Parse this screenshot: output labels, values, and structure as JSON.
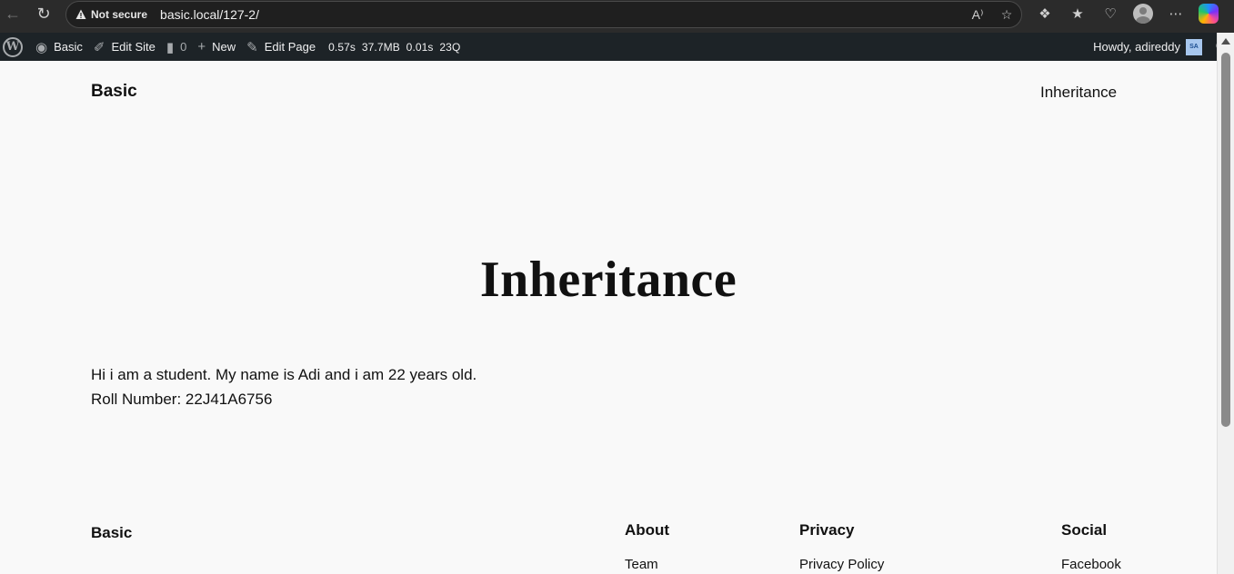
{
  "browser": {
    "security_label": "Not secure",
    "url": "basic.local/127-2/"
  },
  "admin_bar": {
    "site_name": "Basic",
    "edit_site": "Edit Site",
    "comments_count": "0",
    "new_label": "New",
    "edit_page": "Edit Page",
    "stats": "0.57s  37.7MB  0.01s  23Q",
    "howdy": "Howdy, adireddy",
    "avatar_initials": "SA"
  },
  "site": {
    "title": "Basic",
    "nav_link": "Inheritance"
  },
  "page": {
    "title": "Inheritance",
    "lines": [
      "Hi i am a student. My name is Adi and i am 22 years old.",
      "Roll Number: 22J41A6756"
    ]
  },
  "footer": {
    "site_title": "Basic",
    "columns": [
      {
        "heading": "About",
        "link": "Team"
      },
      {
        "heading": "Privacy",
        "link": "Privacy Policy"
      },
      {
        "heading": "Social",
        "link": "Facebook"
      }
    ]
  }
}
